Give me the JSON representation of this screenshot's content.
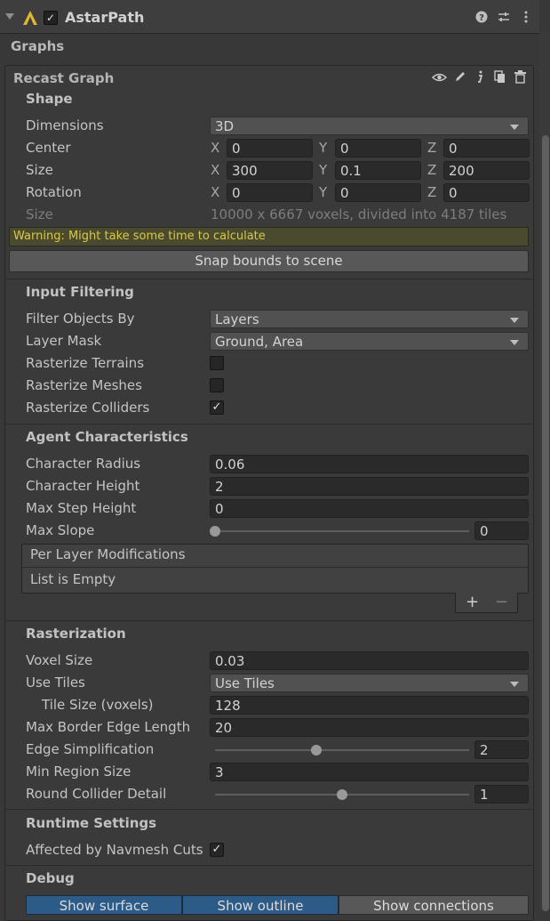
{
  "header": {
    "title": "AstarPath",
    "enabled_check": "✓"
  },
  "graphs_label": "Graphs",
  "graph": {
    "title": "Recast Graph"
  },
  "shape": {
    "title": "Shape",
    "dimensions_label": "Dimensions",
    "dimensions_value": "3D",
    "center_label": "Center",
    "center": {
      "x": "0",
      "y": "0",
      "z": "0"
    },
    "size_label": "Size",
    "size": {
      "x": "300",
      "y": "0.1",
      "z": "200"
    },
    "rotation_label": "Rotation",
    "rotation": {
      "x": "0",
      "y": "0",
      "z": "0"
    },
    "info_label": "Size",
    "info_value": "10000 x 6667 voxels, divided into 4187 tiles",
    "warning": "Warning: Might take some time to calculate",
    "snap_button": "Snap bounds to scene",
    "axis_x": "X",
    "axis_y": "Y",
    "axis_z": "Z"
  },
  "input_filtering": {
    "title": "Input Filtering",
    "filter_label": "Filter Objects By",
    "filter_value": "Layers",
    "layer_mask_label": "Layer Mask",
    "layer_mask_value": "Ground, Area",
    "terrains_label": "Rasterize Terrains",
    "terrains_check": "",
    "meshes_label": "Rasterize Meshes",
    "meshes_check": "",
    "colliders_label": "Rasterize Colliders",
    "colliders_check": "✓"
  },
  "agent": {
    "title": "Agent Characteristics",
    "radius_label": "Character Radius",
    "radius_value": "0.06",
    "height_label": "Character Height",
    "height_value": "2",
    "step_label": "Max Step Height",
    "step_value": "0",
    "slope_label": "Max Slope",
    "slope_value": "0",
    "slope_fraction": 0,
    "per_layer_label": "Per Layer Modifications",
    "list_empty": "List is Empty",
    "add": "+",
    "remove": "−"
  },
  "rasterization": {
    "title": "Rasterization",
    "voxel_label": "Voxel Size",
    "voxel_value": "0.03",
    "tiles_label": "Use Tiles",
    "tiles_value": "Use Tiles",
    "tile_size_label": "Tile Size (voxels)",
    "tile_size_value": "128",
    "border_label": "Max Border Edge Length",
    "border_value": "20",
    "edge_label": "Edge Simplification",
    "edge_value": "2",
    "edge_fraction": 0.4,
    "region_label": "Min Region Size",
    "region_value": "3",
    "round_label": "Round Collider Detail",
    "round_value": "1",
    "round_fraction": 0.5
  },
  "runtime": {
    "title": "Runtime Settings",
    "cuts_label": "Affected by Navmesh Cuts",
    "cuts_check": "✓"
  },
  "debug": {
    "title": "Debug",
    "show_surface": "Show surface",
    "show_outline": "Show outline",
    "show_connections": "Show connections"
  },
  "colors": {
    "accent": "#2d5b87",
    "warning_text": "#d8c94a"
  }
}
